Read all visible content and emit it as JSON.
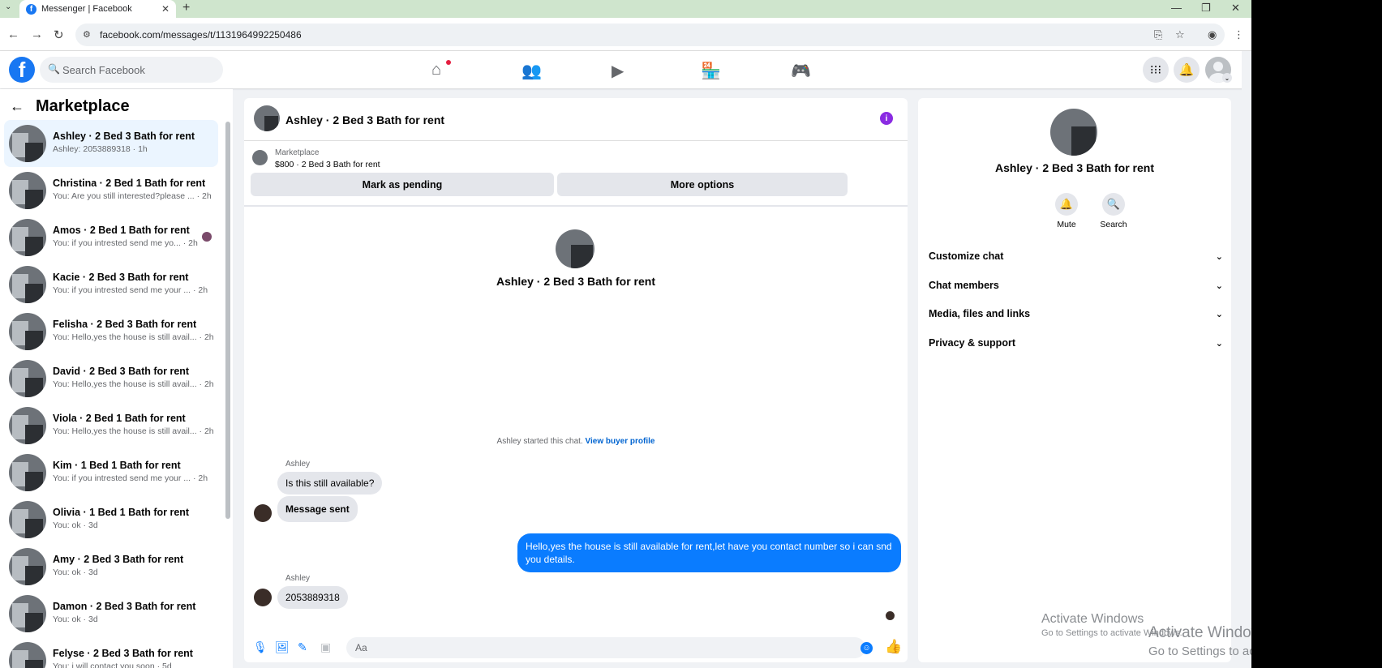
{
  "browser": {
    "tab_title": "Messenger | Facebook",
    "url": "facebook.com/messages/t/1131964992250486"
  },
  "header": {
    "search_placeholder": "Search Facebook"
  },
  "sidebar": {
    "title": "Marketplace",
    "conversations": [
      {
        "name": "Ashley · 2 Bed 3 Bath for rent",
        "preview": "Ashley: 2053889318 · 1h"
      },
      {
        "name": "Christina · 2 Bed 1 Bath for rent",
        "preview": "You: Are you still interested?please ... · 2h"
      },
      {
        "name": "Amos · 2 Bed 1 Bath for rent",
        "preview": "You: if you intrested send me yo... · 2h"
      },
      {
        "name": "Kacie · 2 Bed 3 Bath for rent",
        "preview": "You: if you intrested send me your ... · 2h"
      },
      {
        "name": "Felisha · 2 Bed 3 Bath for rent",
        "preview": "You: Hello,yes the house is still avail... · 2h"
      },
      {
        "name": "David · 2 Bed 3 Bath for rent",
        "preview": "You: Hello,yes the house is still avail... · 2h"
      },
      {
        "name": "Viola · 2 Bed 1 Bath for rent",
        "preview": "You: Hello,yes the house is still avail... · 2h"
      },
      {
        "name": "Kim · 1 Bed 1 Bath for rent",
        "preview": "You: if you intrested send me your ... · 2h"
      },
      {
        "name": "Olivia · 1 Bed 1 Bath for rent",
        "preview": "You: ok · 3d"
      },
      {
        "name": "Amy · 2 Bed 3 Bath for rent",
        "preview": "You: ok · 3d"
      },
      {
        "name": "Damon · 2 Bed 3 Bath for rent",
        "preview": "You: ok · 3d"
      },
      {
        "name": "Felyse · 2 Bed 3 Bath for rent",
        "preview": "You: i will contact you soon · 5d"
      }
    ]
  },
  "chat": {
    "title": "Ashley · 2 Bed 3 Bath for rent",
    "listing_category": "Marketplace",
    "listing_price": "$800 · 2 Bed 3 Bath for rent",
    "mark_pending": "Mark as pending",
    "more_options": "More options",
    "intro_name": "Ashley · 2 Bed 3 Bath for rent",
    "started_text": "Ashley started this chat.",
    "buyer_profile_link": "View buyer profile",
    "sender_1": "Ashley",
    "msg_1": "Is this still available?",
    "msg_2": "Message sent",
    "outgoing": "Hello,yes the house is still available for rent,let have you contact number so i can snd you details.",
    "sender_2": "Ashley",
    "msg_3": "2053889318",
    "input_placeholder": "Aa"
  },
  "details": {
    "name": "Ashley · 2 Bed 3 Bath for rent",
    "mute": "Mute",
    "search": "Search",
    "sections": [
      "Customize chat",
      "Chat members",
      "Media, files and links",
      "Privacy & support"
    ]
  },
  "watermark": {
    "title": "Activate Windows",
    "subtitle": "Go to Settings to activate Windows."
  },
  "colors": {
    "brand": "#1877f2",
    "outgoing_bubble": "#0a7cff",
    "info_icon": "#8a2be2"
  }
}
